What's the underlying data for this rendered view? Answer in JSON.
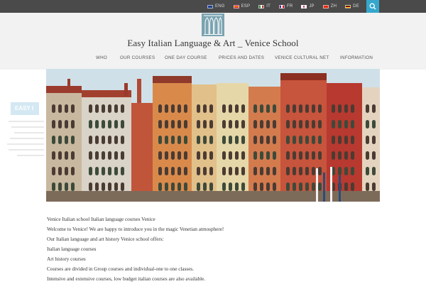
{
  "language_bar": {
    "languages": [
      {
        "label": "ENG",
        "flag_color": "#1f3f8a"
      },
      {
        "label": "ESP",
        "flag_color": "#c8102e"
      },
      {
        "label": "IT",
        "flag_color": "#0a8f3c"
      },
      {
        "label": "FR",
        "flag_color": "#1d3e91"
      },
      {
        "label": "JP",
        "flag_color": "#ffffff"
      },
      {
        "label": "ZH",
        "flag_color": "#de2910"
      },
      {
        "label": "DE",
        "flag_color": "#d4a017"
      }
    ],
    "search_icon": "search-icon"
  },
  "header": {
    "title": "Easy Italian Language & Art _ Venice School"
  },
  "nav": {
    "items": [
      "WHO",
      "OUR COURSES",
      "ONE DAY COURSE",
      "PRICES AND DATES",
      "VENICE CULTURAL NET",
      "INFORMATION"
    ]
  },
  "sidebar": {
    "badge": "EASY I"
  },
  "content": {
    "lines": [
      "Venice Italian school Italian language courses Venice",
      "Welcome to Venice!  We are happy to introduce you in the magic Venetian atmosphere!",
      "Our Italian language and art history Venice school offers:",
      "Italian language courses",
      "Art history courses",
      "Courses are divided in Group courses and individual-one to one classes.",
      "Intensive and extensive courses, low budget italian courses are also available."
    ]
  },
  "colors": {
    "topbar": "#4a4a4a",
    "header_bg": "#f2f2f2",
    "accent": "#35a7cd",
    "logo": "#7aa3b0"
  }
}
